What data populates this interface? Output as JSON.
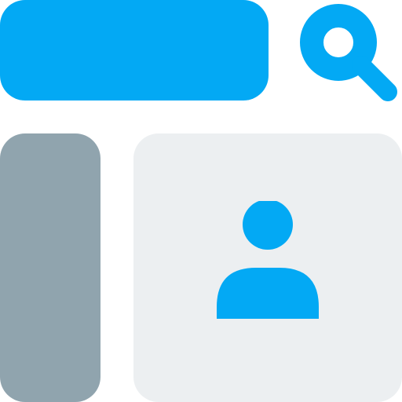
{
  "icons": {
    "search": "search-icon",
    "user": "user-icon"
  },
  "colors": {
    "accent": "#03A9F4",
    "sidebar": "#90A4AE",
    "card": "#ECEFF1",
    "background": "#FFFFFF"
  }
}
